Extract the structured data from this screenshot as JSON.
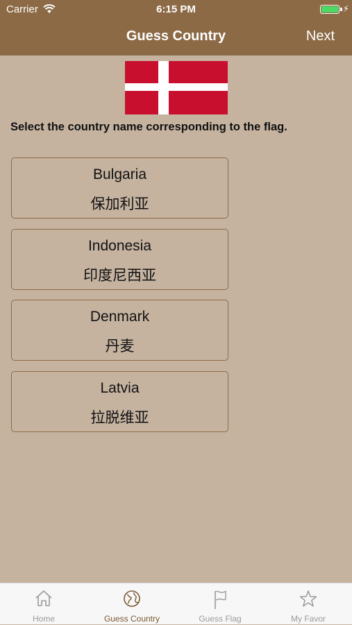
{
  "status_bar": {
    "carrier": "Carrier",
    "time": "6:15 PM"
  },
  "nav": {
    "title": "Guess Country",
    "next_label": "Next"
  },
  "flag": {
    "country_depicted": "Denmark",
    "red": "#c8102e",
    "white": "#ffffff"
  },
  "prompt": "Select the country name corresponding to the flag.",
  "options": [
    {
      "en": "Bulgaria",
      "zh": "保加利亚"
    },
    {
      "en": "Indonesia",
      "zh": "印度尼西亚"
    },
    {
      "en": "Denmark",
      "zh": "丹麦"
    },
    {
      "en": "Latvia",
      "zh": "拉脱维亚"
    }
  ],
  "tabs": [
    {
      "label": "Home",
      "icon": "home-icon"
    },
    {
      "label": "Guess Country",
      "icon": "globe-icon",
      "active": true
    },
    {
      "label": "Guess Flag",
      "icon": "flag-icon"
    },
    {
      "label": "My Favor",
      "icon": "star-icon"
    }
  ],
  "colors": {
    "header": "#8c6a46",
    "background": "#c5b3a0",
    "active_tab": "#7a5a33"
  }
}
